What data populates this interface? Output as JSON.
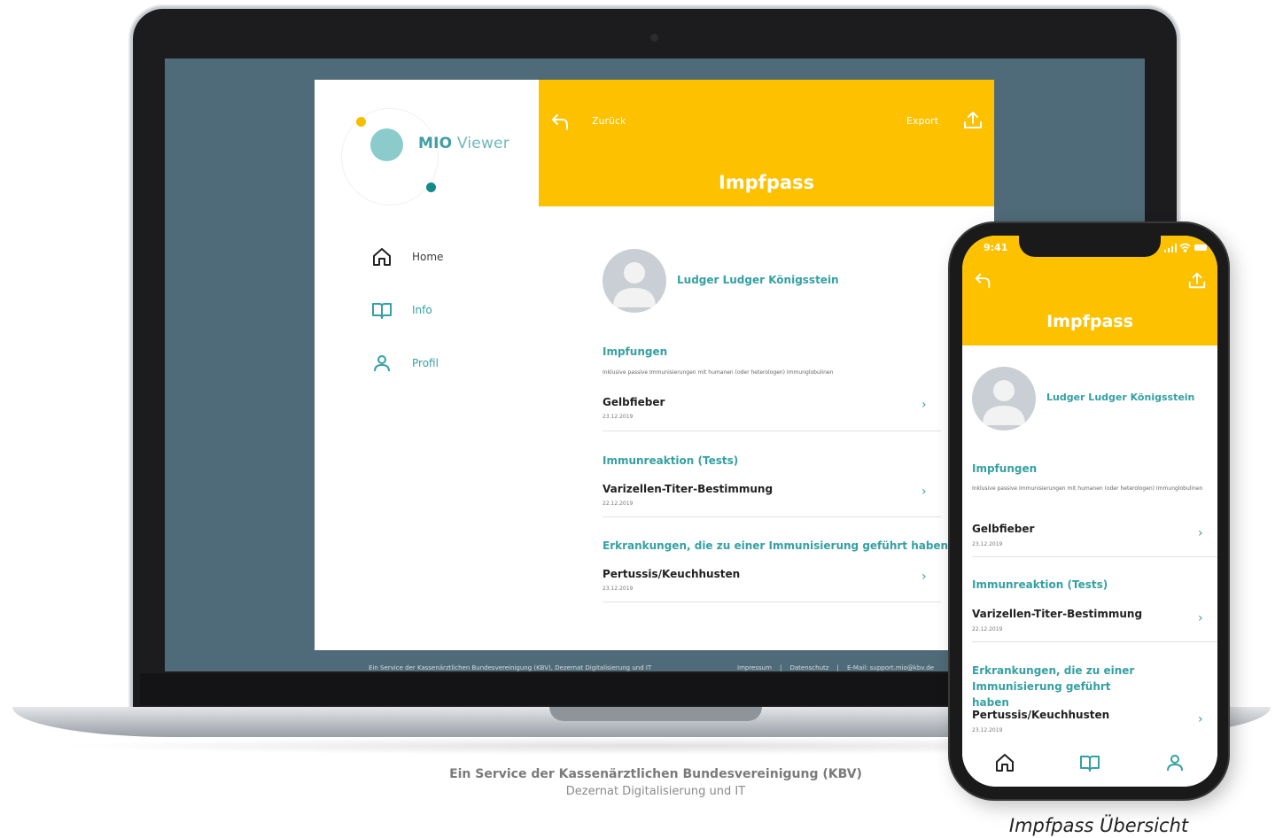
{
  "laptop": {
    "logo": {
      "brand": "MIO",
      "product": "Viewer"
    },
    "nav": [
      {
        "label": "Home",
        "icon": "home-icon"
      },
      {
        "label": "Info",
        "icon": "book-icon"
      },
      {
        "label": "Profil",
        "icon": "user-icon"
      }
    ],
    "header": {
      "back_label": "Zurück",
      "export_label": "Export",
      "title": "Impfpass"
    },
    "patient_name": "Ludger Ludger Königsstein",
    "sections": [
      {
        "title": "Impfungen",
        "subtitle": "Inklusive passive Immunisierungen mit humanen (oder heterologen) Immunglobulinen",
        "entries": [
          {
            "title": "Gelbfieber",
            "date": "23.12.2019"
          }
        ]
      },
      {
        "title": "Immunreaktion (Tests)",
        "entries": [
          {
            "title": "Varizellen-Titer-Bestimmung",
            "date": "22.12.2019"
          }
        ]
      },
      {
        "title": "Erkrankungen, die zu einer Immunisierung geführt haben",
        "entries": [
          {
            "title": "Pertussis/Keuchhusten",
            "date": "23.12.2019"
          }
        ]
      }
    ],
    "footer": {
      "left": "Ein Service der Kassenärztlichen Bundesvereinigung (KBV), Dezernat Digitalisierung und IT",
      "impressum": "Impressum",
      "datenschutz": "Datenschutz",
      "email": "E-Mail: support.mio@kbv.de",
      "separator": "|"
    }
  },
  "phone": {
    "time": "9:41",
    "title": "Impfpass",
    "patient_name": "Ludger Ludger Königsstein",
    "sections": [
      {
        "title": "Impfungen",
        "subtitle": "Inklusive passive Immunisierungen mit humanen (oder heterologen) Immunglobulinen",
        "entries": [
          {
            "title": "Gelbfieber",
            "date": "23.12.2019"
          }
        ]
      },
      {
        "title": "Immunreaktion (Tests)",
        "entries": [
          {
            "title": "Varizellen-Titer-Bestimmung",
            "date": "22.12.2019"
          }
        ]
      },
      {
        "title": "Erkrankungen, die zu einer Immunisierung geführt haben",
        "entries": [
          {
            "title": "Pertussis/Keuchhusten",
            "date": "23.12.2019"
          }
        ]
      }
    ],
    "tabs": [
      "home-icon",
      "book-icon",
      "user-icon"
    ]
  },
  "caption": {
    "main": "Ein Service der Kassenärztlichen Bundesvereinigung (KBV)",
    "sub": "Dezernat Digitalisierung und IT",
    "image": "Impfpass Übersicht"
  },
  "colors": {
    "accent_yellow": "#fdc100",
    "teal": "#35a0a3",
    "screen_bg": "#4f6a78"
  }
}
